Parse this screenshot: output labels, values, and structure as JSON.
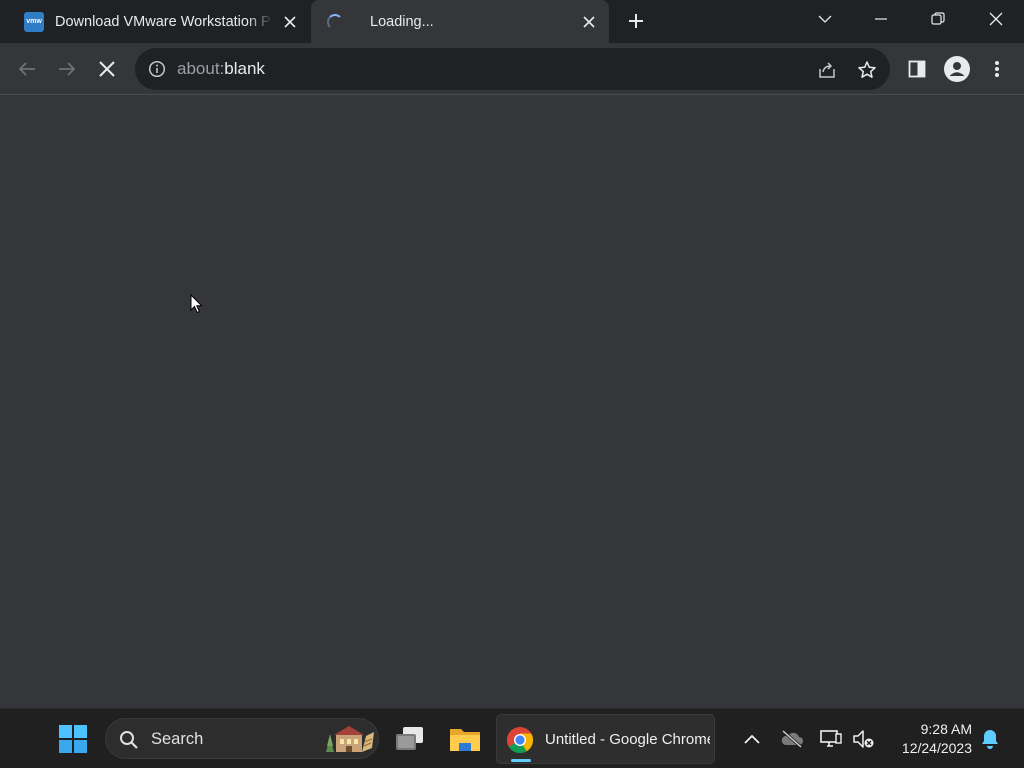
{
  "browser": {
    "tabs": [
      {
        "title": "Download VMware Workstation P",
        "favicon_label": "vmw",
        "active": false
      },
      {
        "title": "Loading...",
        "active": true,
        "loading": true
      }
    ],
    "address_bar": {
      "scheme": "about:",
      "host": "blank"
    },
    "colors": {
      "tabstrip": "#202124",
      "toolbar": "#35363a",
      "omnibox": "#202124",
      "accent": "#8ab4f8"
    }
  },
  "taskbar": {
    "search_label": "Search",
    "chrome_item_label": "Untitled - Google Chrome",
    "clock": {
      "time": "9:28 AM",
      "date": "12/24/2023"
    },
    "icons": [
      "windows-start-icon",
      "search-icon",
      "task-view-icon",
      "file-explorer-icon",
      "chrome-icon",
      "show-hidden-icons-chevron",
      "onedrive-offline-icon",
      "network-icon",
      "volume-muted-icon",
      "notification-bell-icon"
    ]
  }
}
